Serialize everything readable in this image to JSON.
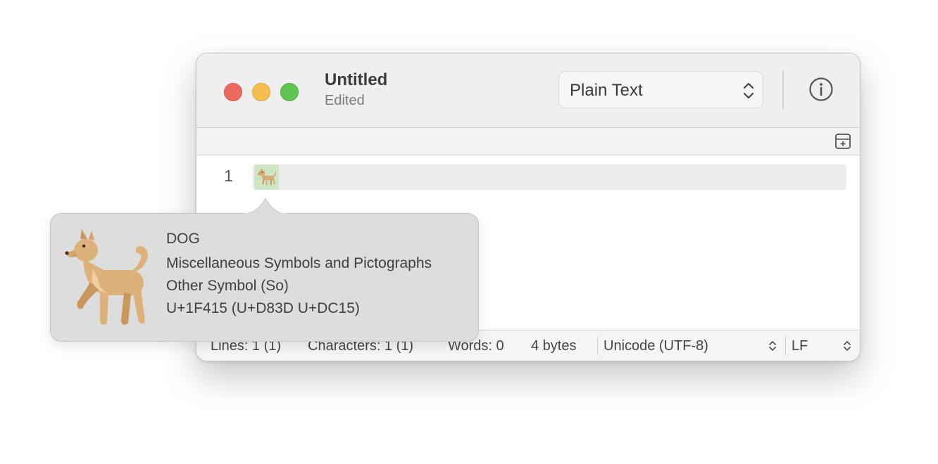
{
  "window": {
    "title": "Untitled",
    "subtitle": "Edited",
    "syntax_mode": "Plain Text"
  },
  "editor": {
    "line_numbers": [
      "1"
    ],
    "content_char_icon": "dog-emoji"
  },
  "status_bar": {
    "lines": "Lines: 1 (1)",
    "characters": "Characters: 1 (1)",
    "words": "Words: 0",
    "bytes": "4 bytes",
    "encoding": "Unicode (UTF-8)",
    "line_ending": "LF"
  },
  "character_info": {
    "name": "DOG",
    "block": "Miscellaneous Symbols and Pictographs",
    "category": "Other Symbol (So)",
    "code_point": "U+1F415 (U+D83D U+DC15)"
  },
  "colors": {
    "close": "#ed6a5e",
    "minimize": "#f5bf4f",
    "zoom": "#61c554",
    "selection": "#cfe6c6"
  }
}
